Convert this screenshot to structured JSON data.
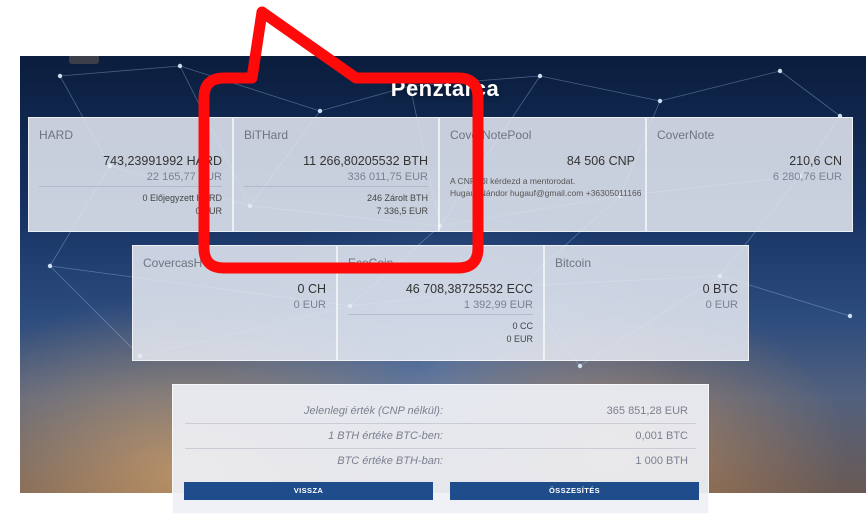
{
  "page_title": "Pénztárca",
  "colors": {
    "accent_button": "#1f4d8c",
    "callout_red": "#ff0a0a",
    "card_bg": "#e6eaf2"
  },
  "cards_row1": [
    {
      "name": "HARD",
      "amount": "743,23991992 HARD",
      "eur": "22 165,77 EUR",
      "extra1": "0 Előjegyzett HARD",
      "extra2": "0 EUR"
    },
    {
      "name": "BiTHard",
      "amount": "11 266,80205532 BTH",
      "eur": "336 011,75 EUR",
      "extra1": "246 Zárolt BTH",
      "extra2": "7 336,5 EUR"
    },
    {
      "name": "CoverNotePool",
      "amount": "84 506 CNP",
      "note1": "A CNP-ről kérdezd a mentorodat.",
      "note2": "Hugauf Nándor hugauf@gmail.com +36305011166"
    },
    {
      "name": "CoverNote",
      "amount": "210,6 CN",
      "eur": "6 280,76 EUR"
    }
  ],
  "cards_row2": [
    {
      "name": "CovercasH",
      "amount": "0 CH",
      "eur": "0 EUR"
    },
    {
      "name": "EcoCoin",
      "amount": "46 708,38725532 ECC",
      "eur": "1 392,99 EUR",
      "extra1": "0 CC",
      "extra2": "0 EUR"
    },
    {
      "name": "Bitcoin",
      "amount": "0 BTC",
      "eur": "0 EUR"
    }
  ],
  "summary": {
    "rows": [
      {
        "label": "Jelenlegi érték (CNP nélkül):",
        "value": "365 851,28 EUR"
      },
      {
        "label": "1 BTH értéke BTC-ben:",
        "value": "0,001 BTC"
      },
      {
        "label": "BTC értéke BTH-ban:",
        "value": "1 000 BTH"
      }
    ],
    "back_button": "VISSZA",
    "summary_button": "ÖSSZESÍTÉS"
  }
}
